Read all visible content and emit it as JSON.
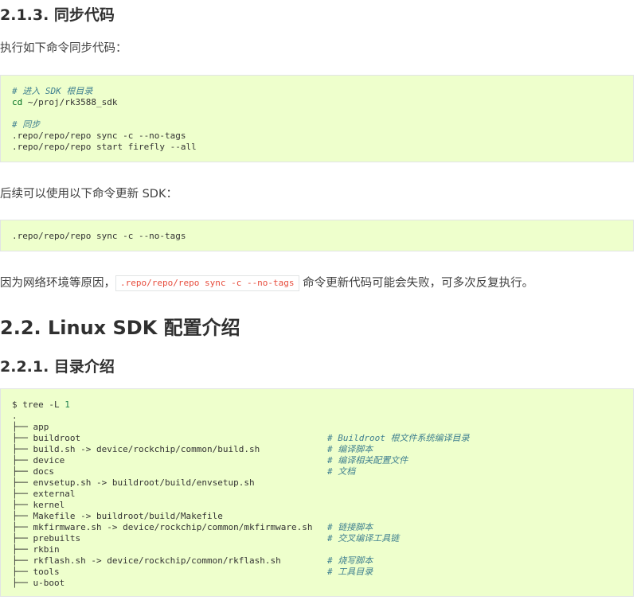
{
  "section_213": {
    "heading": "2.1.3. 同步代码",
    "intro": "执行如下命令同步代码："
  },
  "code_block_1": {
    "comment_enter": "# 进入 SDK 根目录",
    "cd_keyword": "cd",
    "cd_path": " ~/proj/rk3588_sdk",
    "comment_sync": "# 同步",
    "cmd_sync": ".repo/repo/repo sync -c --no-tags",
    "cmd_start": ".repo/repo/repo start firefly --all"
  },
  "update_text": "后续可以使用以下命令更新 SDK：",
  "code_block_2": {
    "cmd": ".repo/repo/repo sync -c --no-tags"
  },
  "note": {
    "before": "因为网络环境等原因，",
    "inline_code": ".repo/repo/repo sync -c --no-tags",
    "after": " 命令更新代码可能会失败，可多次反复执行。"
  },
  "section_22": {
    "heading": "2.2. Linux SDK 配置介绍"
  },
  "section_221": {
    "heading": "2.2.1. 目录介绍"
  },
  "tree_block": {
    "prompt": "$ tree -L ",
    "prompt_num": "1",
    "root": ".",
    "rows": [
      {
        "entry": "├── app",
        "comment": ""
      },
      {
        "entry": "├── buildroot",
        "comment": "# Buildroot 根文件系统编译目录"
      },
      {
        "entry": "├── build.sh -> device/rockchip/common/build.sh",
        "comment": "# 编译脚本"
      },
      {
        "entry": "├── device",
        "comment": "# 编译相关配置文件"
      },
      {
        "entry": "├── docs",
        "comment": "# 文档"
      },
      {
        "entry": "├── envsetup.sh -> buildroot/build/envsetup.sh",
        "comment": ""
      },
      {
        "entry": "├── external",
        "comment": ""
      },
      {
        "entry": "├── kernel",
        "comment": ""
      },
      {
        "entry": "├── Makefile -> buildroot/build/Makefile",
        "comment": ""
      },
      {
        "entry": "├── mkfirmware.sh -> device/rockchip/common/mkfirmware.sh",
        "comment": "# 链接脚本"
      },
      {
        "entry": "├── prebuilts",
        "comment": "# 交叉编译工具链"
      },
      {
        "entry": "├── rkbin",
        "comment": ""
      },
      {
        "entry": "├── rkflash.sh -> device/rockchip/common/rkflash.sh",
        "comment": "# 烧写脚本"
      },
      {
        "entry": "├── tools",
        "comment": "# 工具目录"
      },
      {
        "entry": "├── u-boot",
        "comment": ""
      }
    ]
  }
}
